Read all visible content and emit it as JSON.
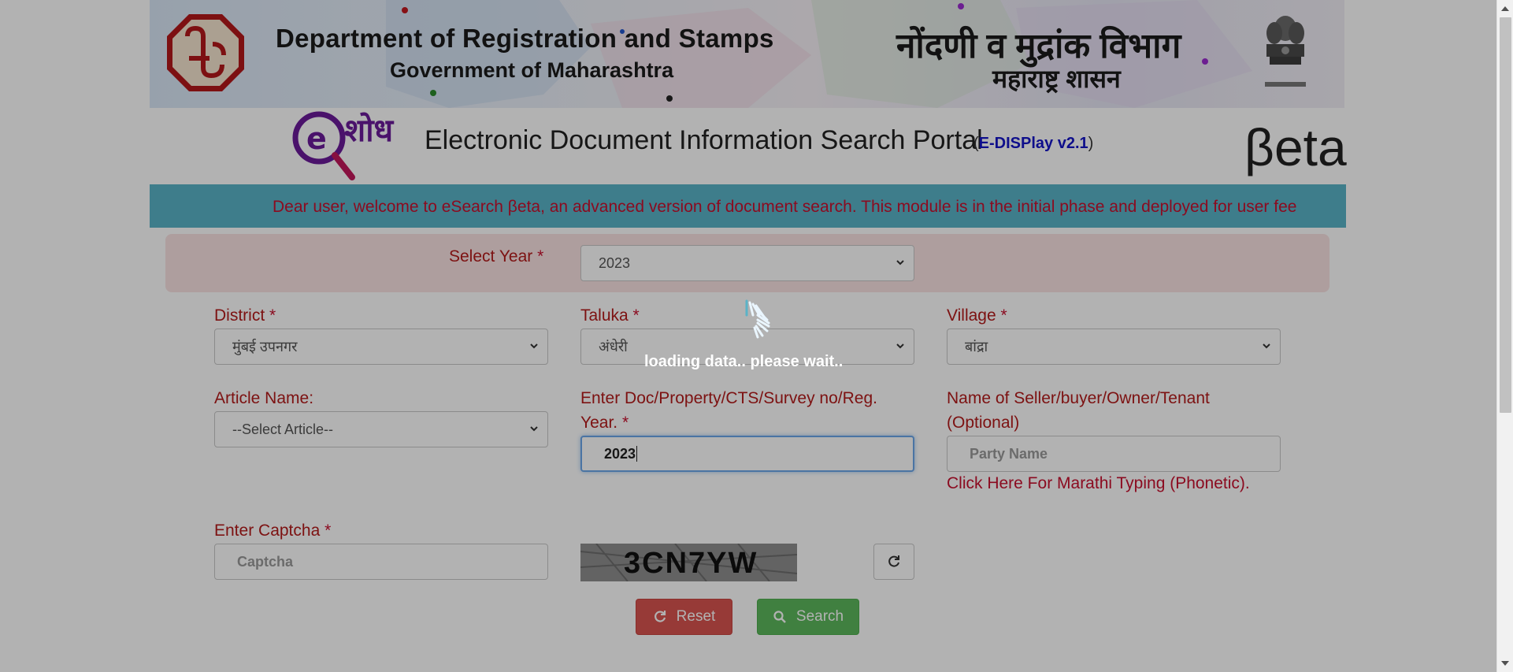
{
  "header": {
    "dept_en": "Department of Registration and Stamps",
    "gov_en": "Government of Maharashtra",
    "dept_mr": "नोंदणी व मुद्रांक विभाग",
    "gov_mr": "महाराष्ट्र शासन"
  },
  "portal": {
    "title": "Electronic Document Information Search Portal",
    "version_open": "(",
    "version": "E-DISPlay v2.1",
    "version_close": ")",
    "beta": "βeta"
  },
  "marquee": {
    "text": "Dear user, welcome to eSearch βeta, an advanced version of document search. This module is in the initial phase and deployed for user fee"
  },
  "form": {
    "year": {
      "label": "Select Year",
      "value": "2023"
    },
    "district": {
      "label": "District",
      "value": "मुंबई उपनगर"
    },
    "taluka": {
      "label": "Taluka",
      "value": "अंधेरी"
    },
    "village": {
      "label": "Village",
      "value": "बांद्रा"
    },
    "article": {
      "label": "Article Name:",
      "value": "--Select Article--"
    },
    "doc_no": {
      "label_line1": "Enter Doc/Property/CTS/Survey no/Reg.",
      "label_line2": "Year.",
      "value": "2023"
    },
    "party": {
      "label_line1": "Name of Seller/buyer/Owner/Tenant",
      "label_line2": "(Optional)",
      "placeholder": "Party Name"
    },
    "marathi_link": "Click Here For Marathi Typing (Phonetic).",
    "captcha": {
      "label": "Enter Captcha",
      "placeholder": "Captcha",
      "image_text": "3CN7YW"
    },
    "required_mark": "*",
    "reset_label": "Reset",
    "search_label": "Search"
  },
  "overlay": {
    "loading_text": "loading data.. please wait.."
  },
  "colors": {
    "label": "#b31b1b",
    "marquee_bg": "#5ab3c7",
    "reset_bg": "#d9534f",
    "search_bg": "#5cb85c",
    "version_blue": "#1515c8"
  }
}
